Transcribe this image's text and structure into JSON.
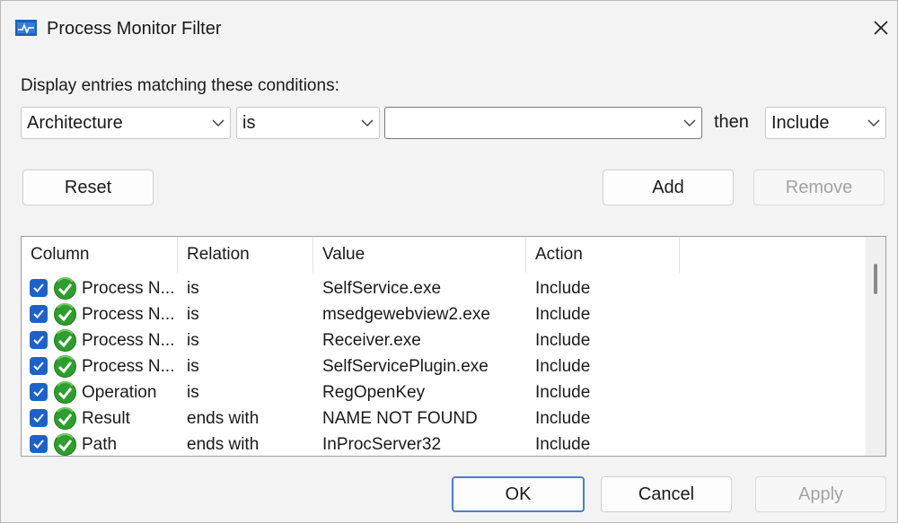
{
  "window": {
    "title": "Process Monitor Filter",
    "icon": "process-monitor-app-icon"
  },
  "filter": {
    "conditions_label": "Display entries matching these conditions:",
    "column_value": "Architecture",
    "relation_value": "is",
    "value_value": "",
    "then_label": "then",
    "action_value": "Include"
  },
  "buttons": {
    "reset": "Reset",
    "add": "Add",
    "remove": "Remove",
    "ok": "OK",
    "cancel": "Cancel",
    "apply": "Apply"
  },
  "table": {
    "headers": [
      "Column",
      "Relation",
      "Value",
      "Action"
    ],
    "rows": [
      {
        "column": "Process N...",
        "relation": "is",
        "value": "SelfService.exe",
        "action": "Include"
      },
      {
        "column": "Process N...",
        "relation": "is",
        "value": "msedgewebview2.exe",
        "action": "Include"
      },
      {
        "column": "Process N...",
        "relation": "is",
        "value": "Receiver.exe",
        "action": "Include"
      },
      {
        "column": "Process N...",
        "relation": "is",
        "value": "SelfServicePlugin.exe",
        "action": "Include"
      },
      {
        "column": "Operation",
        "relation": "is",
        "value": "RegOpenKey",
        "action": "Include"
      },
      {
        "column": "Result",
        "relation": "ends with",
        "value": "NAME NOT FOUND",
        "action": "Include"
      },
      {
        "column": "Path",
        "relation": "ends with",
        "value": "InProcServer32",
        "action": "Include"
      }
    ]
  },
  "colors": {
    "checkbox": "#1e62c8",
    "ok_icon": "#2e9e2e",
    "default_button_border": "#4a7fd0"
  }
}
